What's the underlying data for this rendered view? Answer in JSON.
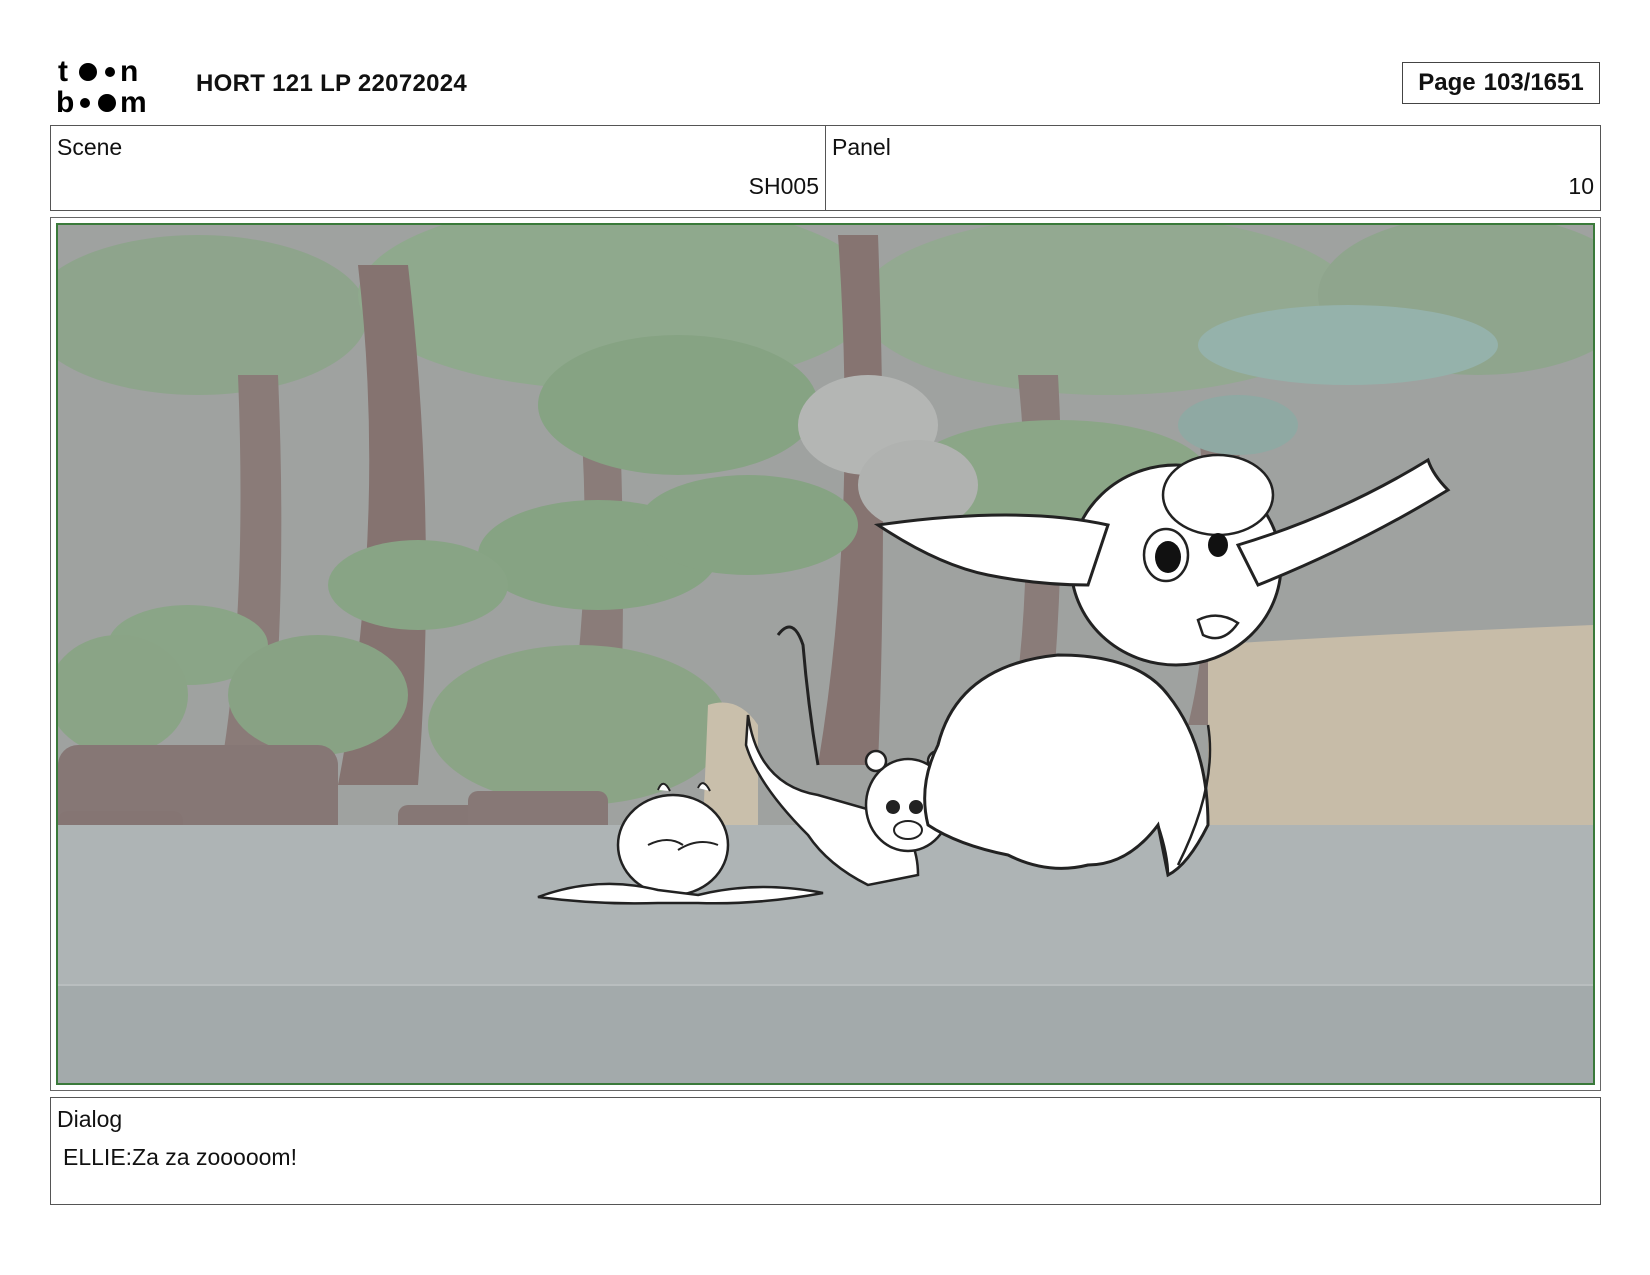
{
  "header": {
    "logo_text": "toon boom",
    "project_title": "HORT 121 LP 22072024",
    "page_label": "Page",
    "page_number": "103/1651"
  },
  "scene": {
    "label": "Scene",
    "value": "SH005"
  },
  "panel": {
    "label": "Panel",
    "value": "10"
  },
  "dialog": {
    "label": "Dialog",
    "text": "ELLIE:Za za zooooom!"
  }
}
